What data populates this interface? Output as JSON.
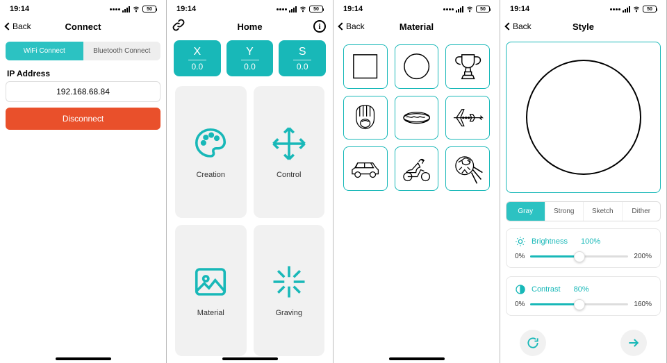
{
  "status": {
    "time": "19:14",
    "battery": "50"
  },
  "s1": {
    "back": "Back",
    "title": "Connect",
    "tabs": [
      "WiFi Connect",
      "Bluetooth Connect"
    ],
    "ip_label": "IP Address",
    "ip_value": "192.168.68.84",
    "disconnect": "Disconnect"
  },
  "s2": {
    "title": "Home",
    "metrics": [
      {
        "k": "X",
        "v": "0.0"
      },
      {
        "k": "Y",
        "v": "0.0"
      },
      {
        "k": "S",
        "v": "0.0"
      }
    ],
    "tiles": [
      "Creation",
      "Control",
      "Material",
      "Graving"
    ]
  },
  "s3": {
    "back": "Back",
    "title": "Material",
    "items": [
      "square",
      "circle",
      "trophy",
      "glove",
      "hotdog",
      "airplane",
      "car",
      "scooter",
      "soccerball"
    ]
  },
  "s4": {
    "back": "Back",
    "title": "Style",
    "tabs": [
      "Gray",
      "Strong",
      "Sketch",
      "Dither"
    ],
    "brightness": {
      "label": "Brightness",
      "value": "100%",
      "min": "0%",
      "max": "200%",
      "pct": 50
    },
    "contrast": {
      "label": "Contrast",
      "value": "80%",
      "min": "0%",
      "max": "160%",
      "pct": 50
    }
  }
}
